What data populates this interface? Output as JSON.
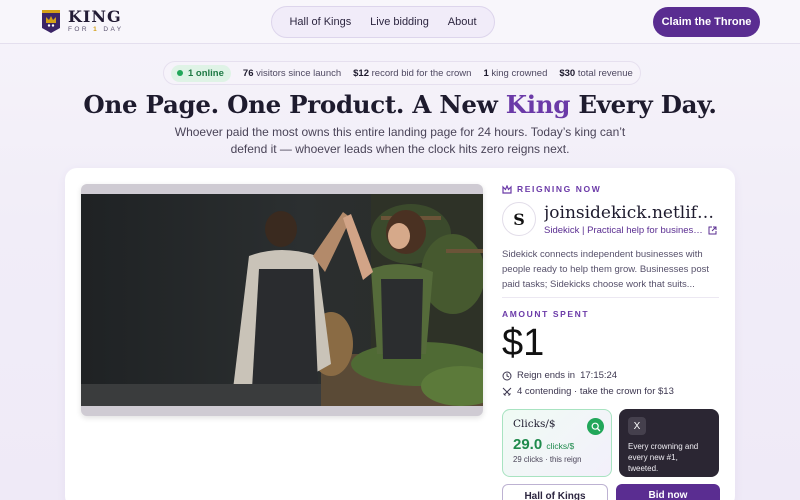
{
  "header": {
    "logo_title": "KING",
    "logo_sub_prefix": "FOR",
    "logo_sub_number": "1",
    "logo_sub_suffix": "DAY",
    "nav": [
      "Hall of Kings",
      "Live bidding",
      "About"
    ],
    "cta_label": "Claim the Throne"
  },
  "stats": {
    "online": "1 online",
    "visitors_value": "76",
    "visitors_label": "visitors since launch",
    "record_value": "$12",
    "record_label": "record bid for the crown",
    "kings_value": "1",
    "kings_label": "king crowned",
    "revenue_value": "$30",
    "revenue_label": "total revenue"
  },
  "hero": {
    "title_before": "One Page. One Product. A New ",
    "title_highlight": "King",
    "title_after": " Every Day.",
    "subtitle": "Whoever paid the most owns this entire landing page for 24 hours. Today’s king can’t defend it — whoever leads when the clock hits zero reigns next."
  },
  "reign": {
    "label": "REIGNING NOW",
    "site_logo_glyph": "S",
    "site_name": "joinsidekick.netlify.app",
    "site_tagline": "Sidekick | Practical help for business owners",
    "description": "Sidekick connects independent businesses with people ready to help them grow. Businesses post paid tasks; Sidekicks choose work that suits...",
    "amount_label": "AMOUNT SPENT",
    "amount": "$1",
    "reign_ends": "Reign ends in",
    "countdown": "17:15:24",
    "contending": "4 contending · take the crown for $13"
  },
  "tiles": {
    "clicks_title": "Clicks/$",
    "clicks_value": "29.0",
    "clicks_unit": "clicks/$",
    "clicks_detail": "29 clicks · this reign",
    "x_glyph": "X",
    "x_text": "Every crowning and every new #1, tweeted."
  },
  "actions": {
    "hall_label": "Hall of Kings",
    "bid_label": "Bid now"
  },
  "colors": {
    "brand": "#5a2d91",
    "accent_purple": "#6b3aa8",
    "success_green": "#22a75a",
    "gold": "#d4a017"
  },
  "icons": [
    "crown-logo-icon",
    "crown-icon",
    "external-link-icon",
    "clock-icon",
    "swords-icon",
    "search-chart-icon",
    "x-logo-icon"
  ]
}
